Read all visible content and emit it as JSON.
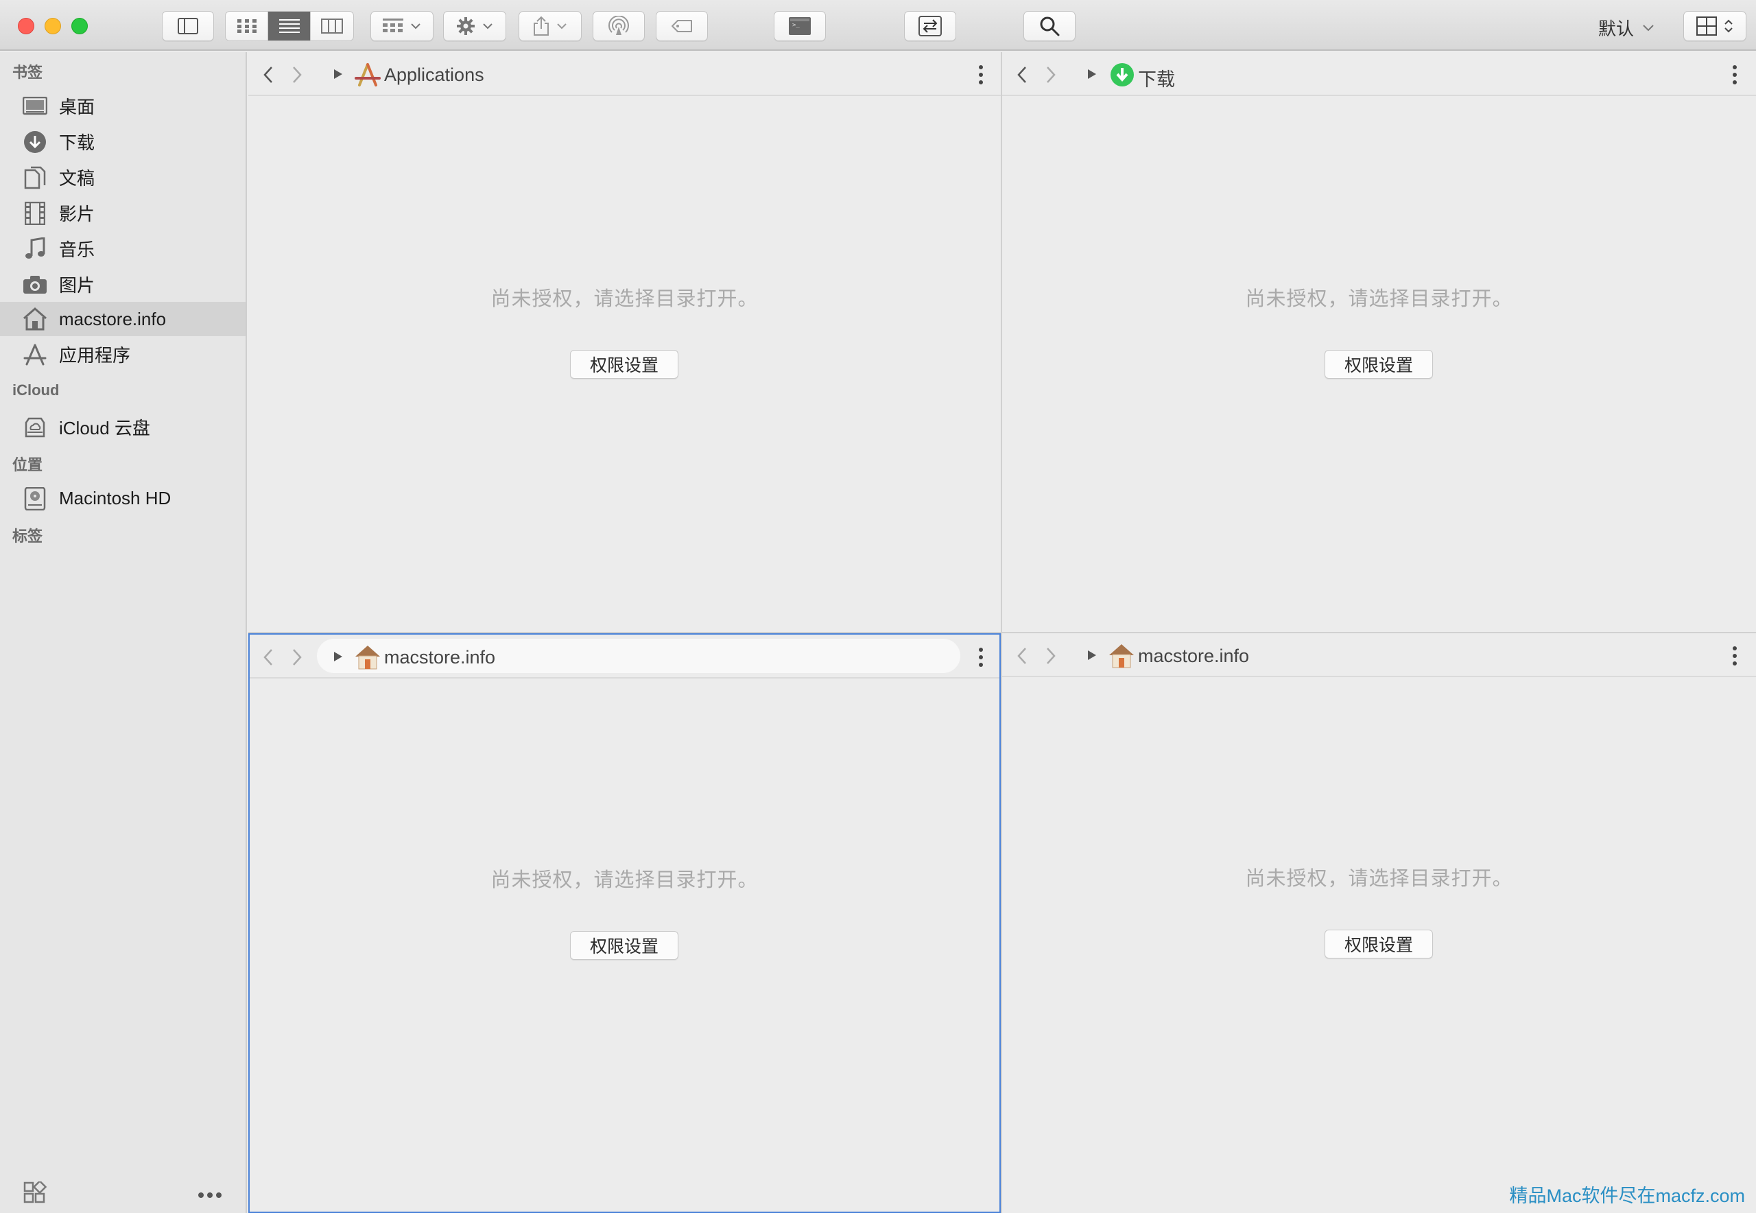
{
  "window": {
    "profile_label": "默认"
  },
  "sidebar": {
    "sections": {
      "bookmarks": "书签",
      "icloud": "iCloud",
      "locations": "位置",
      "tags": "标签"
    },
    "items": [
      {
        "label": "桌面",
        "icon": "desktop-icon"
      },
      {
        "label": "下载",
        "icon": "download-icon"
      },
      {
        "label": "文稿",
        "icon": "documents-icon"
      },
      {
        "label": "影片",
        "icon": "film-icon"
      },
      {
        "label": "音乐",
        "icon": "music-icon"
      },
      {
        "label": "图片",
        "icon": "camera-icon"
      },
      {
        "label": "macstore.info",
        "icon": "home-icon",
        "selected": true
      },
      {
        "label": "应用程序",
        "icon": "applications-icon"
      },
      {
        "label": "iCloud 云盘",
        "icon": "icloud-drive-icon"
      },
      {
        "label": "Macintosh HD",
        "icon": "hard-disk-icon"
      }
    ]
  },
  "panes": [
    {
      "path": "Applications",
      "icon": "applications-folder-icon",
      "message": "尚未授权，请选择目录打开。",
      "button": "权限设置"
    },
    {
      "path": "下载",
      "icon": "download-folder-icon",
      "message": "尚未授权，请选择目录打开。",
      "button": "权限设置"
    },
    {
      "path": "macstore.info",
      "icon": "home-folder-icon",
      "message": "尚未授权，请选择目录打开。",
      "button": "权限设置",
      "active": true
    },
    {
      "path": "macstore.info",
      "icon": "home-folder-icon",
      "message": "尚未授权，请选择目录打开。",
      "button": "权限设置"
    }
  ],
  "watermark": "精品Mac软件尽在macfz.com",
  "colors": {
    "accent": "#4a82d8",
    "selection": "#d3d3d3",
    "download_green": "#34c759",
    "watermark": "#2a8fc4"
  }
}
